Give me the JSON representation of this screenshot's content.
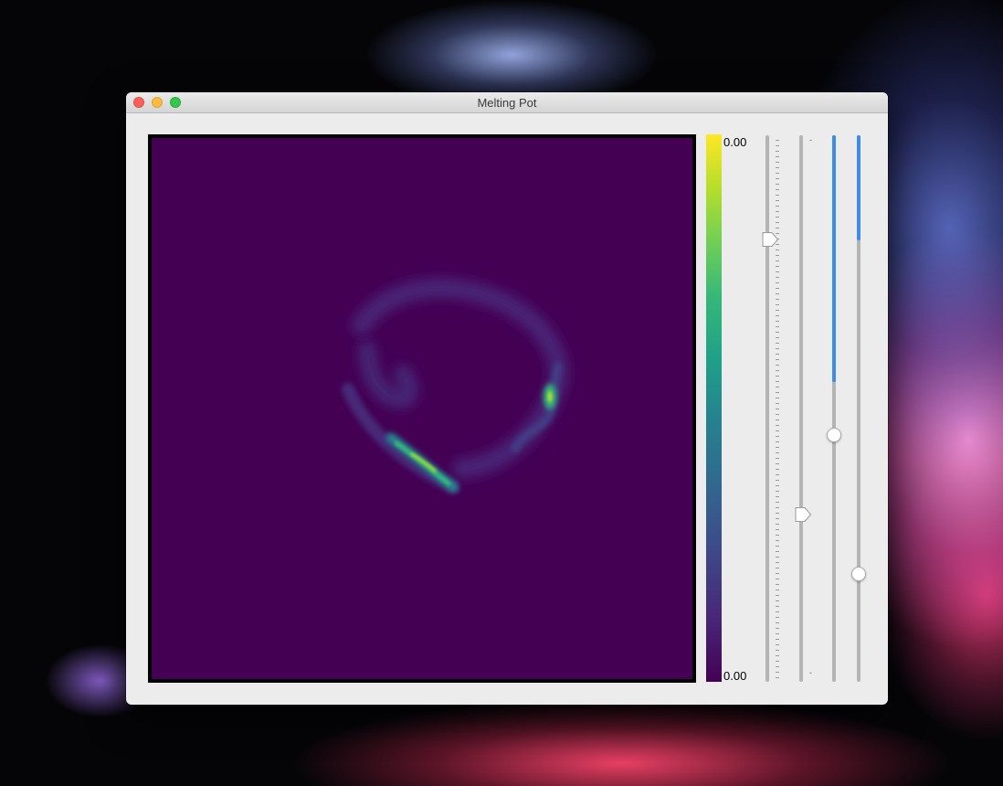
{
  "window": {
    "title": "Melting Pot",
    "traffic_lights": {
      "close": "#fc605c",
      "minimize": "#fdbc40",
      "maximize": "#34c84a"
    }
  },
  "plot": {
    "colormap": "viridis",
    "background_color": "#440154"
  },
  "colorbar": {
    "top_label": "0.00",
    "bottom_label": "0.00"
  },
  "sliders": [
    {
      "name": "slider-1",
      "style": "ticked-pointer",
      "value": 0.82
    },
    {
      "name": "slider-2",
      "style": "pointer",
      "value": 0.3,
      "tick_marks": [
        "-",
        "-"
      ]
    },
    {
      "name": "slider-3",
      "style": "round",
      "value": 0.45,
      "fill_color": "#3e8de4"
    },
    {
      "name": "slider-4",
      "style": "round",
      "value": 0.2,
      "fill_color": "#3e8de4"
    }
  ],
  "icons": {
    "close": "close-icon",
    "minimize": "minimize-icon",
    "maximize": "maximize-icon",
    "slider_handle": "slider-handle-icon"
  }
}
